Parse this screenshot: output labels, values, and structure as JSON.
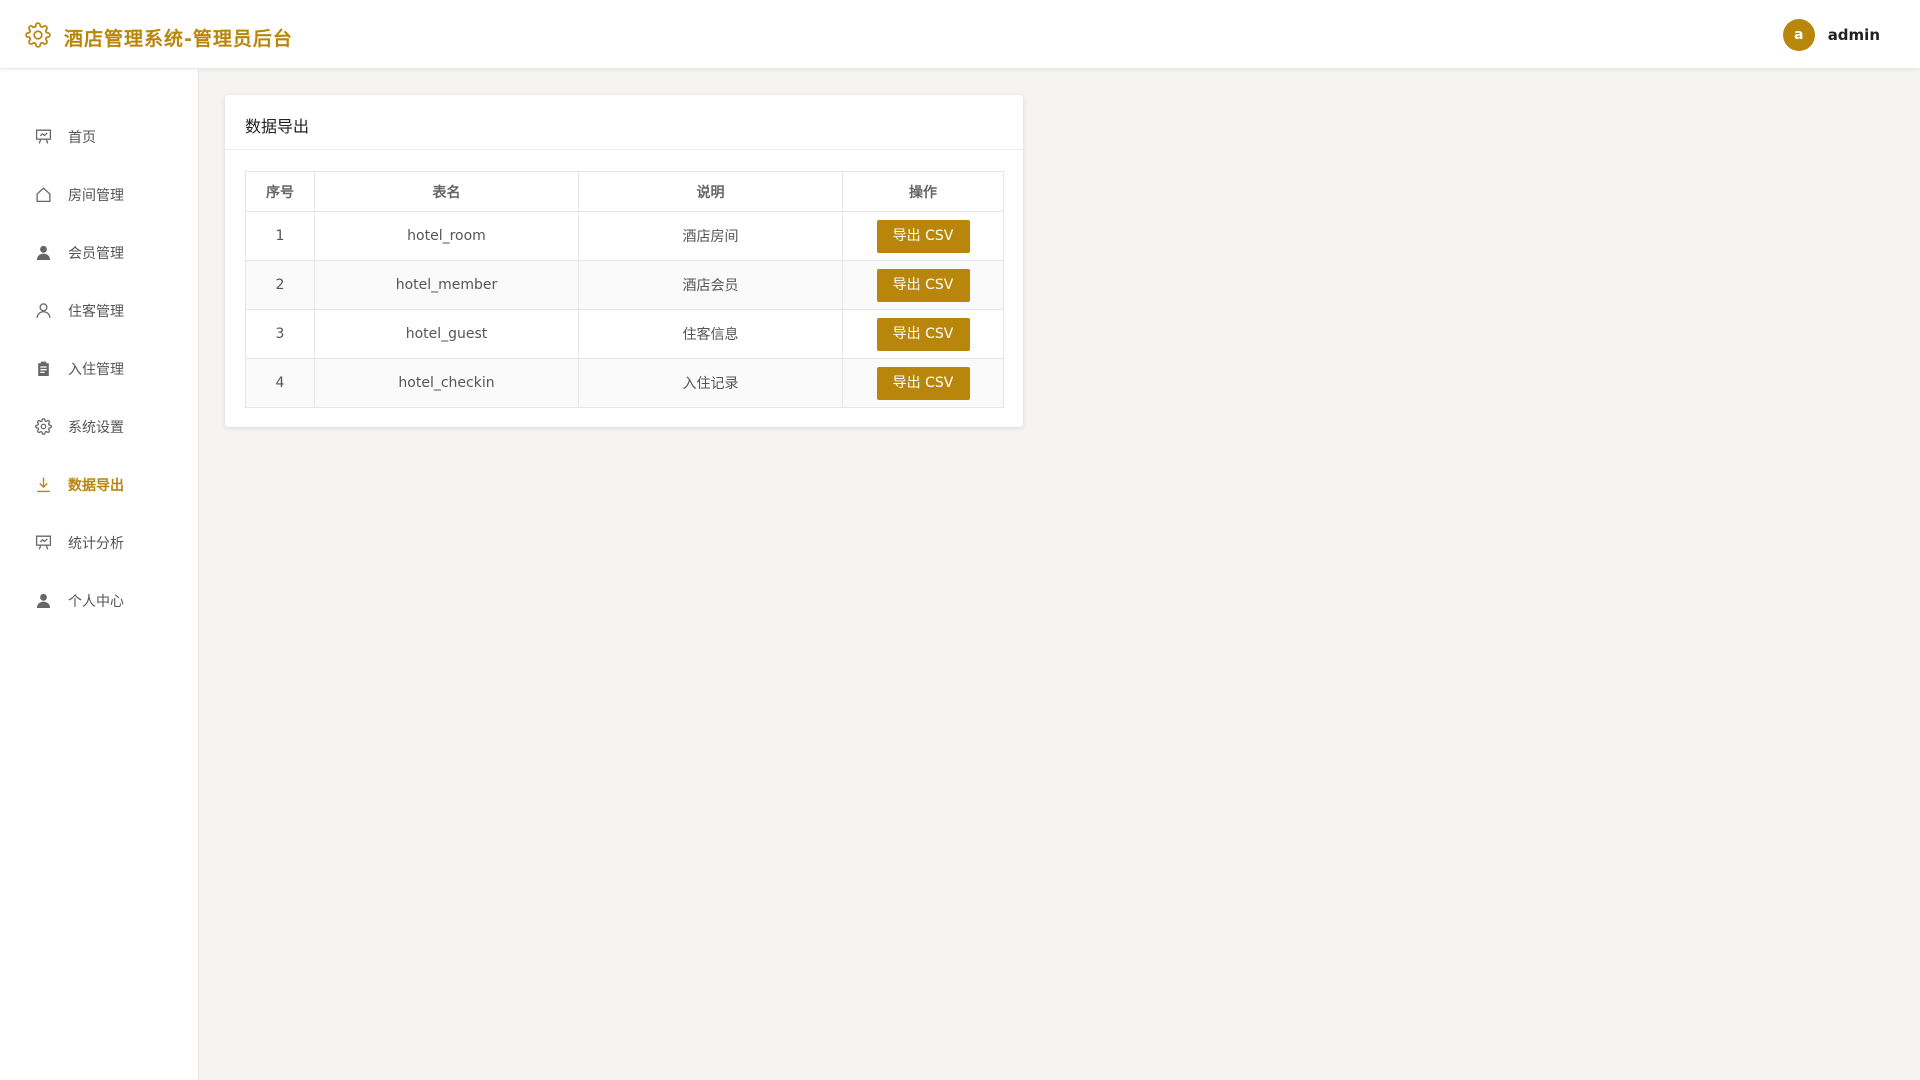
{
  "app": {
    "title": "酒店管理系统-管理员后台"
  },
  "user": {
    "avatar_letter": "a",
    "name": "admin"
  },
  "colors": {
    "accent": "#b8860b",
    "background": "#f6f4f0"
  },
  "sidebar": {
    "items": [
      {
        "label": "首页",
        "icon": "presentation-icon",
        "active": false
      },
      {
        "label": "房间管理",
        "icon": "home-icon",
        "active": false
      },
      {
        "label": "会员管理",
        "icon": "user-filled-icon",
        "active": false
      },
      {
        "label": "住客管理",
        "icon": "user-outline-icon",
        "active": false
      },
      {
        "label": "入住管理",
        "icon": "clipboard-icon",
        "active": false
      },
      {
        "label": "系统设置",
        "icon": "gear-icon",
        "active": false
      },
      {
        "label": "数据导出",
        "icon": "download-icon",
        "active": true
      },
      {
        "label": "统计分析",
        "icon": "presentation-icon",
        "active": false
      },
      {
        "label": "个人中心",
        "icon": "user-filled-icon",
        "active": false
      }
    ]
  },
  "main": {
    "card_title": "数据导出",
    "table": {
      "headers": [
        "序号",
        "表名",
        "说明",
        "操作"
      ],
      "rows": [
        {
          "index": "1",
          "table_name": "hotel_room",
          "description": "酒店房间",
          "action": "导出 CSV"
        },
        {
          "index": "2",
          "table_name": "hotel_member",
          "description": "酒店会员",
          "action": "导出 CSV"
        },
        {
          "index": "3",
          "table_name": "hotel_guest",
          "description": "住客信息",
          "action": "导出 CSV"
        },
        {
          "index": "4",
          "table_name": "hotel_checkin",
          "description": "入住记录",
          "action": "导出 CSV"
        }
      ]
    }
  }
}
